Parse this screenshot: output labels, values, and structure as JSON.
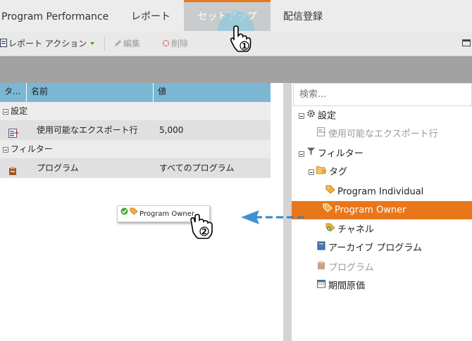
{
  "tabs": {
    "app_title": "Program Performance",
    "report": "レポート",
    "setup": "セットアップ",
    "delivery": "配信登録"
  },
  "toolbar": {
    "report_action": "レポート アクション",
    "edit": "編集",
    "delete": "削除"
  },
  "grid": {
    "headers": {
      "type": "タ...",
      "name": "名前",
      "value": "値"
    },
    "groups": [
      {
        "label": "設定",
        "rows": [
          {
            "icon": "export-rows-icon",
            "name": "使用可能なエクスポート行",
            "value": "5,000"
          }
        ]
      },
      {
        "label": "フィルター",
        "rows": [
          {
            "icon": "program-icon",
            "name": "プログラム",
            "value": "すべてのプログラム"
          }
        ]
      }
    ]
  },
  "tree": {
    "search_placeholder": "検索...",
    "settings": "設定",
    "export_rows": "使用可能なエクスポート行",
    "filters": "フィルター",
    "tags": "タグ",
    "program_individual": "Program Individual",
    "program_owner": "Program Owner",
    "channel": "チャネル",
    "archive_program": "アーカイブ プログラム",
    "program": "プログラム",
    "period_cost": "期間原価"
  },
  "drag": {
    "label": "Program Owner"
  },
  "steps": {
    "step1": "1",
    "step2": "2"
  },
  "colors": {
    "accent": "#e8771a",
    "grid_header": "#7bb6d2",
    "arrow": "#2f86c6"
  }
}
